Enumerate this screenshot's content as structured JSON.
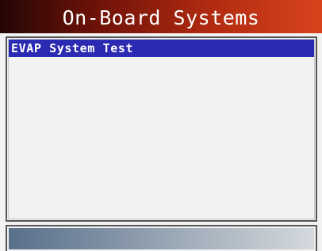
{
  "screen": {
    "title": "On-Board Systems"
  },
  "menu": {
    "items": [
      {
        "label": "EVAP System Test",
        "selected": true
      }
    ]
  },
  "colors": {
    "title_bar_gradient": [
      "#240606",
      "#6e1208",
      "#b02a10",
      "#d8431c"
    ],
    "selection_highlight": "#2a2ab2",
    "footer_gradient": [
      "#59708a",
      "#7c8ea2",
      "#a9b4bf",
      "#d4d9de"
    ],
    "background": "#f2f2f2"
  }
}
